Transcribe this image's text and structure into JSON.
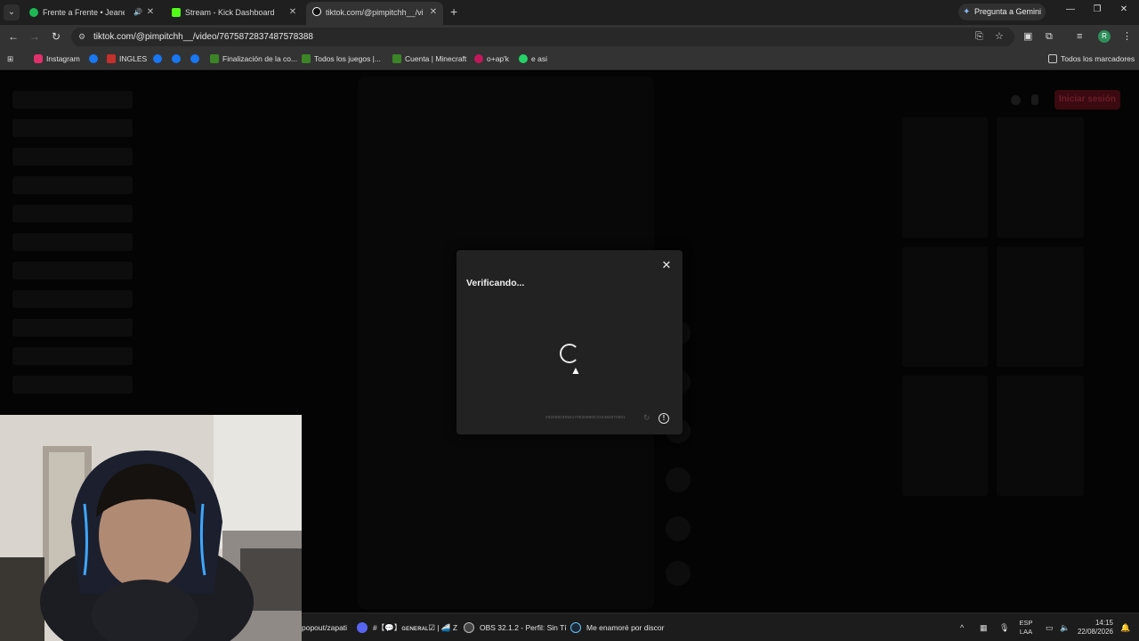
{
  "tabs": [
    {
      "label": "Frente a Frente • Jeanette",
      "favicon": "spotify-icon",
      "color": "#1db954"
    },
    {
      "label": "Stream - Kick Dashboard",
      "favicon": "kick-icon",
      "color": "#53fc18"
    },
    {
      "label": "tiktok.com/@pimpitchh__/video",
      "favicon": "tiktok-icon",
      "color": "#ffffff"
    }
  ],
  "gemini_label": "Pregunta a Gemini",
  "url": "tiktok.com/@pimpitchh__/video/7675872837487578388",
  "bookmarks": [
    {
      "label": "Instagram",
      "color": "#e1306c"
    },
    {
      "label": "",
      "color": "#1877f2"
    },
    {
      "label": "INGLES",
      "color": "#c4302b"
    },
    {
      "label": "",
      "color": "#1877f2"
    },
    {
      "label": "",
      "color": "#1877f2"
    },
    {
      "label": "",
      "color": "#1877f2"
    },
    {
      "label": "Finalización de la co...",
      "color": "#3c8527"
    },
    {
      "label": "Todos los juegos |...",
      "color": "#3c8527"
    },
    {
      "label": "Cuenta | Minecraft",
      "color": "#3c8527"
    },
    {
      "label": "o+ap'k",
      "color": "#c2185b"
    },
    {
      "label": "e asi",
      "color": "#25d366"
    }
  ],
  "all_bookmarks_label": "Todos los marcadores",
  "login_button": "Iniciar sesión",
  "modal": {
    "title": "Verificando...",
    "id_text": "20260823055170530990C024384970601"
  },
  "taskbar": {
    "items": [
      {
        "label": "popout/zapati",
        "color": ""
      },
      {
        "label": "#【💬】ɢᴇɴᴇʀᴀʟ☑ | 🚄 Z",
        "color": "#5865f2"
      },
      {
        "label": "OBS 32.1.2 - Perfil: Sin Tí",
        "color": "#444444"
      },
      {
        "label": "Me enamoré por discor",
        "color": "#1b2838"
      }
    ],
    "lang_top": "ESP",
    "lang_bottom": "LAA",
    "time": "14:15",
    "date": "22/08/2026"
  }
}
